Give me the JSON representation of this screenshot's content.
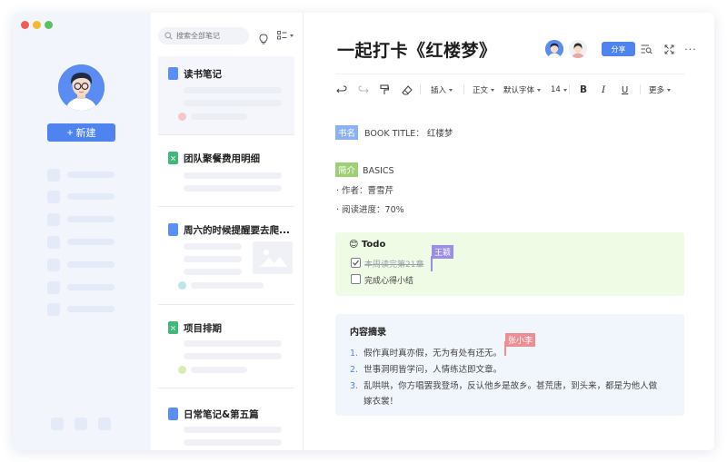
{
  "colors": {
    "accent": "#4e83f0",
    "sidebar_bg": "#f2f5fc",
    "traffic_red": "#ee5b55",
    "traffic_yellow": "#f5b92f",
    "traffic_green": "#5ac25d",
    "tag_blue": "#8ab1f4",
    "tag_green": "#9fcf75",
    "cursor_purple": "#9b8ee8",
    "cursor_pink": "#ee8d92"
  },
  "sidebar": {
    "new_button_label": "新建",
    "new_button_icon": "plus-icon"
  },
  "notes": {
    "search_placeholder": "搜索全部笔记",
    "items": [
      {
        "title": "读书笔记",
        "icon": "doc-icon"
      },
      {
        "title": "团队聚餐费用明细",
        "icon": "spreadsheet-icon"
      },
      {
        "title": "周六的时候提醒要去爬...",
        "icon": "doc-icon"
      },
      {
        "title": "项目排期",
        "icon": "spreadsheet-icon"
      },
      {
        "title": "日常笔记&第五篇",
        "icon": "doc-icon"
      }
    ]
  },
  "editor": {
    "title": "一起打卡《红楼梦》",
    "share_label": "分享",
    "more_label": "···",
    "toolbar": {
      "insert": "插入",
      "paragraph": "正文",
      "font": "默认字体",
      "size": "14",
      "bold": "B",
      "italic": "I",
      "underline": "U",
      "more": "更多"
    },
    "book_tag": "书名",
    "book_line": "BOOK TITLE： 红楼梦",
    "intro_tag": "简介",
    "intro_line": "BASICS",
    "author_line": "· 作者：曹雪芹",
    "progress_line": "· 阅读进度：70%",
    "todo": {
      "emoji": "😊",
      "heading": "Todo",
      "items": [
        {
          "text": "本周读完第21章",
          "checked": true
        },
        {
          "text": "完成心得小结",
          "checked": false
        }
      ],
      "collaborator": "王颖"
    },
    "summary": {
      "heading": "内容摘录",
      "items": [
        {
          "num": "1.",
          "text": "假作真时真亦假，无为有处有还无。"
        },
        {
          "num": "2.",
          "text": "世事洞明皆学问，人情练达即文章。"
        },
        {
          "num": "3.",
          "text": "乱哄哄，你方唱罢我登场，反认他乡是故乡。甚荒唐，到头来，都是为他人做"
        },
        {
          "num": "",
          "text": "嫁衣裳！"
        }
      ],
      "collaborator": "张小李"
    }
  }
}
